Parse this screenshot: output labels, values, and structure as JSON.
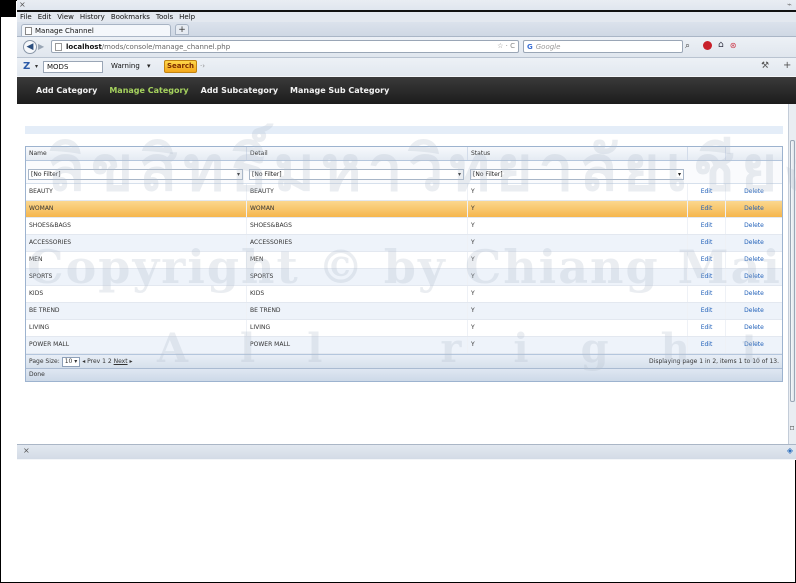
{
  "window": {
    "close_symbol": "×"
  },
  "menubar": {
    "items": [
      "File",
      "Edit",
      "View",
      "History",
      "Bookmarks",
      "Tools",
      "Help"
    ]
  },
  "tab": {
    "title": "Manage Channel",
    "new_tab": "+"
  },
  "navbar": {
    "back": "◀",
    "forward": "▶",
    "url_host": "localhost",
    "url_path": "/mods/console/manage_channel.php",
    "url_right": "☆ · C",
    "search_engine": "G",
    "search_placeholder": "Google"
  },
  "toolbar": {
    "logo": "Z",
    "input_value": "MODS",
    "warning_label": "Warning",
    "search_button": "Search"
  },
  "appnav": {
    "items": [
      {
        "label": "Add Category",
        "active": false
      },
      {
        "label": "Manage Category",
        "active": true
      },
      {
        "label": "Add Subcategory",
        "active": false
      },
      {
        "label": "Manage Sub Category",
        "active": false
      }
    ]
  },
  "grid": {
    "columns": [
      "Name",
      "Detail",
      "Status",
      "",
      ""
    ],
    "filter_value": "[No Filter]",
    "rows": [
      {
        "name": "BEAUTY",
        "detail": "BEAUTY",
        "status": "Y",
        "edit": "Edit",
        "delete": "Delete"
      },
      {
        "name": "WOMAN",
        "detail": "WOMAN",
        "status": "Y",
        "edit": "Edit",
        "delete": "Delete"
      },
      {
        "name": "SHOES&BAGS",
        "detail": "SHOES&BAGS",
        "status": "Y",
        "edit": "Edit",
        "delete": "Delete"
      },
      {
        "name": "ACCESSORIES",
        "detail": "ACCESSORIES",
        "status": "Y",
        "edit": "Edit",
        "delete": "Delete"
      },
      {
        "name": "MEN",
        "detail": "MEN",
        "status": "Y",
        "edit": "Edit",
        "delete": "Delete"
      },
      {
        "name": "SPORTS",
        "detail": "SPORTS",
        "status": "Y",
        "edit": "Edit",
        "delete": "Delete"
      },
      {
        "name": "KIDS",
        "detail": "KIDS",
        "status": "Y",
        "edit": "Edit",
        "delete": "Delete"
      },
      {
        "name": "BE TREND",
        "detail": "BE TREND",
        "status": "Y",
        "edit": "Edit",
        "delete": "Delete"
      },
      {
        "name": "LIVING",
        "detail": "LIVING",
        "status": "Y",
        "edit": "Edit",
        "delete": "Delete"
      },
      {
        "name": "POWER MALL",
        "detail": "POWER MALL",
        "status": "Y",
        "edit": "Edit",
        "delete": "Delete"
      }
    ],
    "selected_row": 1,
    "pager": {
      "page_size_label": "Page Size:",
      "page_size": "10",
      "prev": "◂ Prev",
      "pages": "1 2",
      "next": "Next",
      "summary": "Displaying page 1 in 2, items 1 to 10 of 13."
    },
    "status": "Done"
  },
  "watermark": {
    "line1": "ลิขสิทธิ์มหาวิทยาลัยเชียงใหม่",
    "line2": "Copyright © by Chiang Mai University",
    "line3": "All rights reserved"
  },
  "colors": {
    "nav_active": "#a5d25e",
    "row_selected": "#f5b64d",
    "link": "#1f5fb8"
  }
}
